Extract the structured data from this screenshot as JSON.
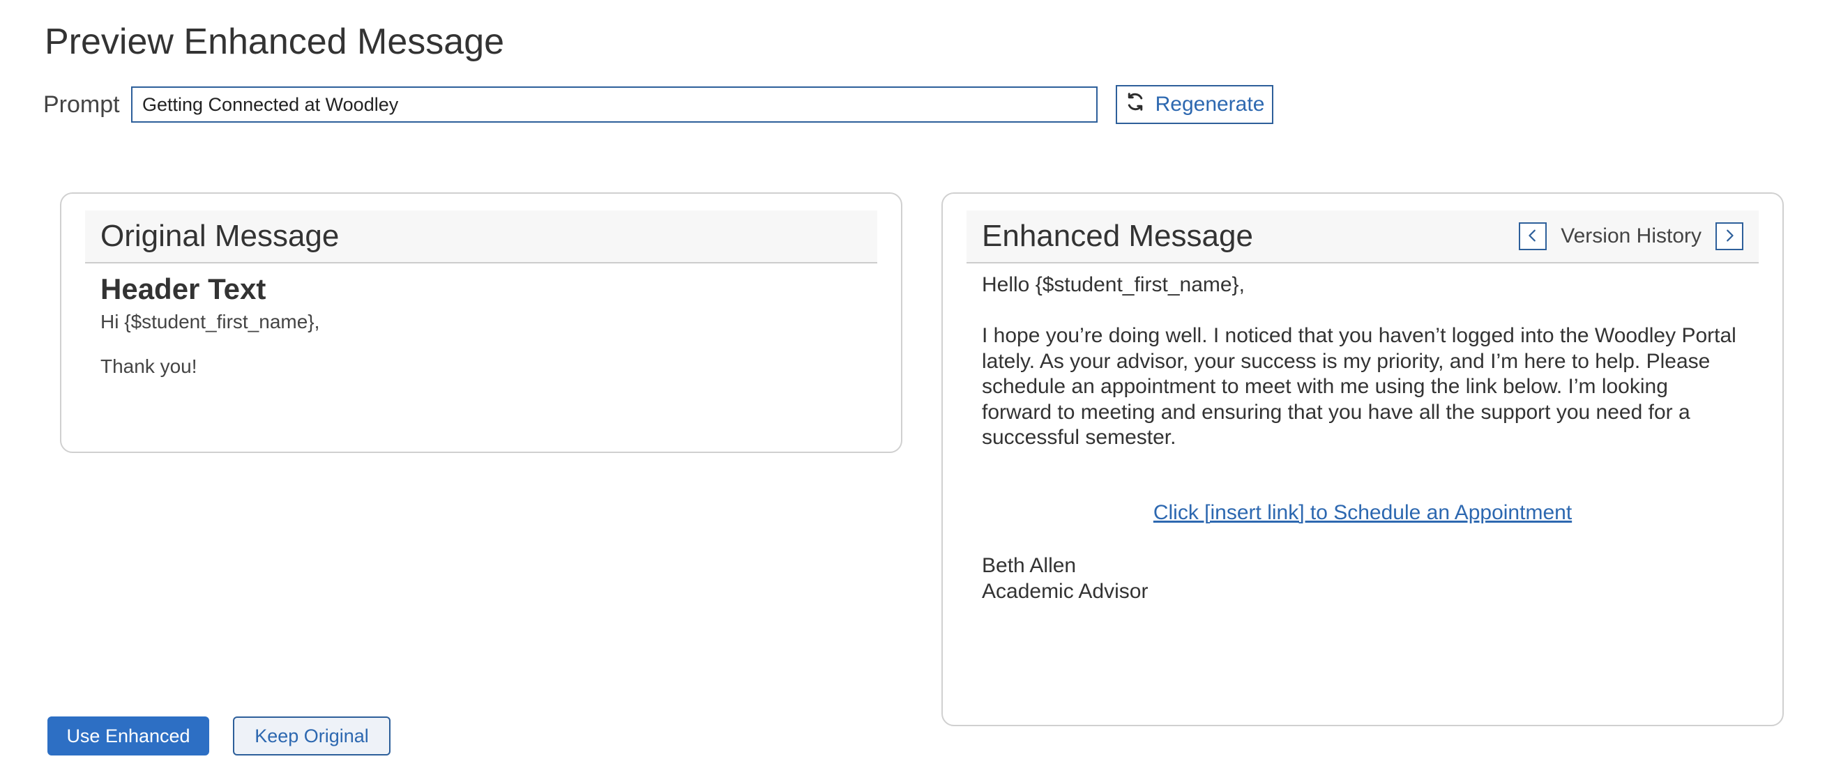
{
  "page": {
    "title": "Preview Enhanced Message"
  },
  "prompt": {
    "label": "Prompt",
    "value": "Getting Connected at Woodley",
    "regenerate_label": "Regenerate",
    "regenerate_icon": "refresh-icon"
  },
  "original": {
    "title": "Original Message",
    "header_text": "Header Text",
    "greeting": "Hi {$student_first_name},",
    "closing": "Thank you!"
  },
  "enhanced": {
    "title": "Enhanced Message",
    "version_history_label": "Version History",
    "prev_icon": "chevron-left-icon",
    "next_icon": "chevron-right-icon",
    "greeting": "Hello {$student_first_name},",
    "body": "I hope you’re doing well. I noticed that you haven’t logged into the Woodley Portal lately. As your advisor, your success is my priority, and I’m here to help. Please schedule an appointment to meet with me using the link below. I’m looking forward to meeting and ensuring that you have all the support you need for a successful semester.",
    "link_text": "Click [insert link] to Schedule an Appointment",
    "signature_name": "Beth Allen",
    "signature_title": "Academic Advisor"
  },
  "actions": {
    "use_enhanced_label": "Use Enhanced",
    "keep_original_label": "Keep Original"
  },
  "colors": {
    "accent": "#2d6fc4",
    "border": "#2d5f9a",
    "link": "#2d68b0"
  }
}
